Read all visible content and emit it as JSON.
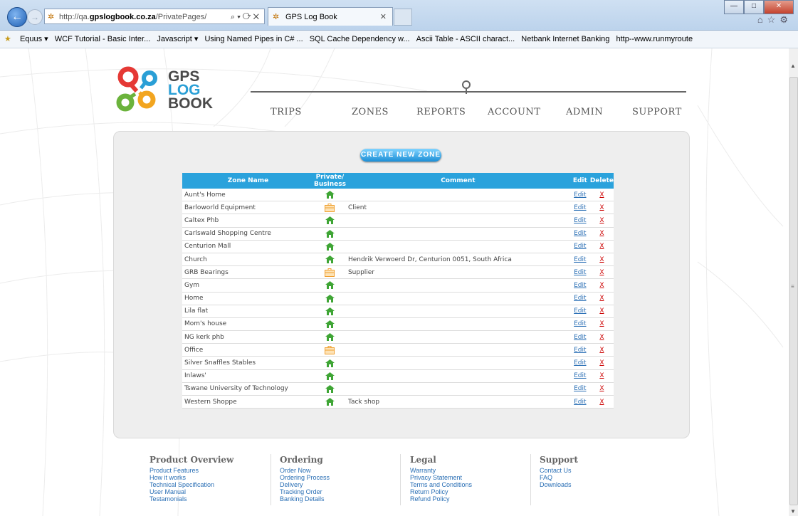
{
  "browser": {
    "url_prefix": "http://qa.",
    "url_domain": "gpslogbook.co.za",
    "url_path": "/PrivatePages/",
    "tab_title": "GPS Log Book",
    "favorites": [
      "Equus ▾",
      "WCF Tutorial - Basic Inter...",
      "Javascript ▾",
      "Using Named Pipes in C# ...",
      "SQL Cache Dependency w...",
      "Ascii Table - ASCII charact...",
      "Netbank Internet Banking",
      "http--www.runmyroute"
    ]
  },
  "logo": {
    "line1": "GPS",
    "line2": "LOG",
    "line3": "BOOK"
  },
  "nav": [
    "TRIPS",
    "ZONES",
    "REPORTS",
    "ACCOUNT",
    "ADMIN",
    "SUPPORT"
  ],
  "create_button": "CREATE NEW ZONE",
  "table": {
    "headers": {
      "name": "Zone Name",
      "type_line1": "Private/",
      "type_line2": "Business",
      "comment": "Comment",
      "edit": "Edit",
      "delete": "Delete"
    },
    "rows": [
      {
        "name": "Aunt's Home",
        "type": "private",
        "comment": "",
        "edit": "Edit",
        "delete": "X"
      },
      {
        "name": "Barloworld Equipment",
        "type": "business",
        "comment": "Client",
        "edit": "Edit",
        "delete": "X"
      },
      {
        "name": "Caltex Phb",
        "type": "private",
        "comment": "",
        "edit": "Edit",
        "delete": "X"
      },
      {
        "name": "Carlswald Shopping Centre",
        "type": "private",
        "comment": "",
        "edit": "Edit",
        "delete": "X"
      },
      {
        "name": "Centurion Mall",
        "type": "private",
        "comment": "",
        "edit": "Edit",
        "delete": "X"
      },
      {
        "name": "Church",
        "type": "private",
        "comment": "Hendrik Verwoerd Dr, Centurion 0051, South Africa",
        "edit": "Edit",
        "delete": "X"
      },
      {
        "name": "GRB Bearings",
        "type": "business",
        "comment": "Supplier",
        "edit": "Edit",
        "delete": "X"
      },
      {
        "name": "Gym",
        "type": "private",
        "comment": "",
        "edit": "Edit",
        "delete": "X"
      },
      {
        "name": "Home",
        "type": "private",
        "comment": "",
        "edit": "Edit",
        "delete": "X"
      },
      {
        "name": "Lila flat",
        "type": "private",
        "comment": "",
        "edit": "Edit",
        "delete": "X"
      },
      {
        "name": "Mom's house",
        "type": "private",
        "comment": "",
        "edit": "Edit",
        "delete": "X"
      },
      {
        "name": "NG kerk phb",
        "type": "private",
        "comment": "",
        "edit": "Edit",
        "delete": "X"
      },
      {
        "name": "Office",
        "type": "business",
        "comment": "",
        "edit": "Edit",
        "delete": "X"
      },
      {
        "name": "Silver Snaffles Stables",
        "type": "private",
        "comment": "",
        "edit": "Edit",
        "delete": "X"
      },
      {
        "name": "Inlaws'",
        "type": "private",
        "comment": "",
        "edit": "Edit",
        "delete": "X"
      },
      {
        "name": "Tswane University of Technology",
        "type": "private",
        "comment": "",
        "edit": "Edit",
        "delete": "X"
      },
      {
        "name": "Western Shoppe",
        "type": "private",
        "comment": "Tack shop",
        "edit": "Edit",
        "delete": "X"
      }
    ]
  },
  "footer": [
    {
      "heading": "Product Overview",
      "links": [
        "Product Features",
        "How it works",
        "Technical Specification",
        "User Manual",
        "Testamonials"
      ]
    },
    {
      "heading": "Ordering",
      "links": [
        "Order Now",
        "Ordering Process",
        "Delivery",
        "Tracking Order",
        "Banking Details"
      ]
    },
    {
      "heading": "Legal",
      "links": [
        "Warranty",
        "Privacy Statement",
        "Terms and Conditions",
        "Return Policy",
        "Refund Policy"
      ]
    },
    {
      "heading": "Support",
      "links": [
        "Contact Us",
        "FAQ",
        "Downloads"
      ]
    }
  ],
  "colors": {
    "accent": "#2aa2dc",
    "house": "#3fa535",
    "briefcase": "#f0a030",
    "link": "#2a6fb5"
  }
}
